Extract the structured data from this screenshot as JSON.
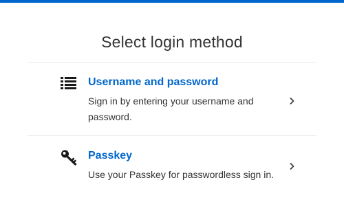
{
  "page": {
    "title": "Select login method",
    "accent_color": "#0066cc"
  },
  "methods": [
    {
      "title": "Username and password",
      "description": "Sign in by entering your username and password.",
      "icon": "list-icon"
    },
    {
      "title": "Passkey",
      "description": "Use your Passkey for passwordless sign in.",
      "icon": "key-icon"
    }
  ]
}
